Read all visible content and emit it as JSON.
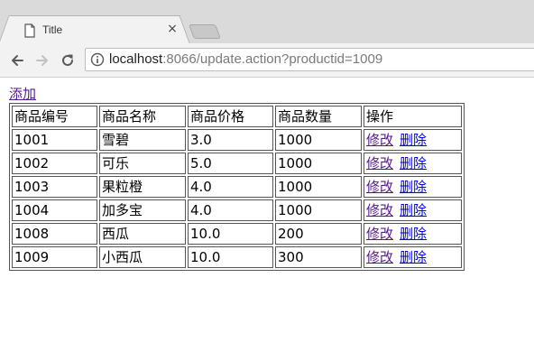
{
  "browser": {
    "tab_title": "Title",
    "tab_close": "×",
    "url_host": "localhost",
    "url_rest": ":8066/update.action?productid=1009"
  },
  "page": {
    "add_link": "添加",
    "table": {
      "headers": [
        "商品编号",
        "商品名称",
        "商品价格",
        "商品数量",
        "操作"
      ],
      "rows": [
        {
          "id": "1001",
          "name": "雪碧",
          "price": "3.0",
          "qty": "1000",
          "edit": "修改",
          "delete": "删除"
        },
        {
          "id": "1002",
          "name": "可乐",
          "price": "5.0",
          "qty": "1000",
          "edit": "修改",
          "delete": "删除"
        },
        {
          "id": "1003",
          "name": "果粒橙",
          "price": "4.0",
          "qty": "1000",
          "edit": "修改",
          "delete": "删除"
        },
        {
          "id": "1004",
          "name": "加多宝",
          "price": "4.0",
          "qty": "1000",
          "edit": "修改",
          "delete": "删除"
        },
        {
          "id": "1008",
          "name": "西瓜",
          "price": "10.0",
          "qty": "200",
          "edit": "修改",
          "delete": "删除"
        },
        {
          "id": "1009",
          "name": "小西瓜",
          "price": "10.0",
          "qty": "300",
          "edit": "修改",
          "delete": "删除"
        }
      ]
    }
  },
  "colors": {
    "visited_link": "#551a8b",
    "unvisited_link": "#0000ee",
    "chrome_bg": "#f2f2f2"
  }
}
